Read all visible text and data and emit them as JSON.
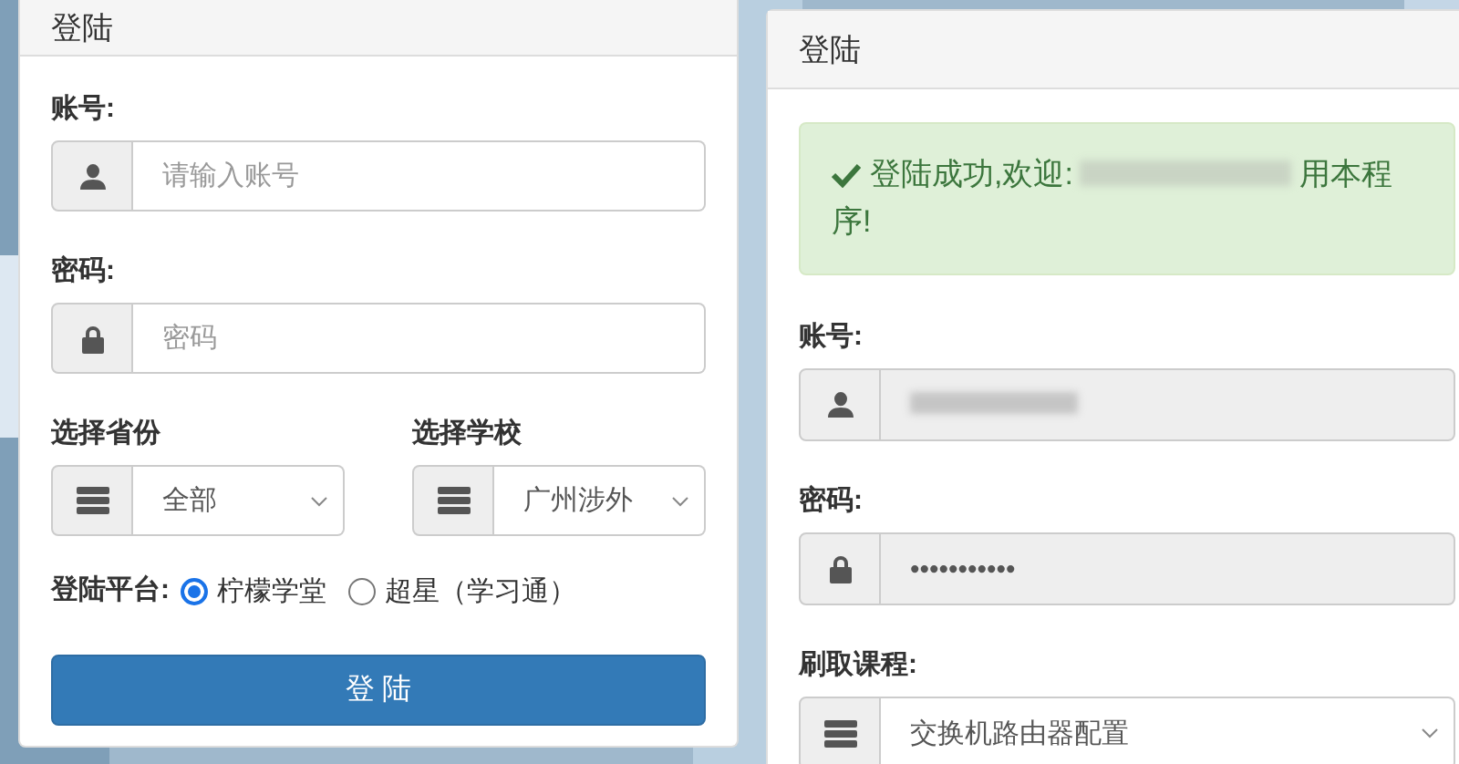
{
  "panels": [
    {
      "title": "登陆",
      "fields": [
        {
          "kind": "account",
          "label": "账号:",
          "placeholder": "请输入账号",
          "disabled": false
        },
        {
          "kind": "password",
          "label": "密码:",
          "placeholder": "密码",
          "disabled": false
        }
      ],
      "selects": [
        {
          "label": "选择省份",
          "value": "全部"
        },
        {
          "label": "选择学校",
          "value": "广州涉外"
        }
      ],
      "platform": {
        "label": "登陆平台:",
        "options": [
          {
            "label": "柠檬学堂",
            "selected": true
          },
          {
            "label": "超星（学习通）",
            "selected": false
          }
        ]
      },
      "button": "登 陆"
    },
    {
      "title": "登陆",
      "alert": {
        "before": "登陆成功,欢迎:",
        "redacted": true,
        "after": "用本程序!"
      },
      "fields": [
        {
          "kind": "account",
          "label": "账号:",
          "redacted": true,
          "disabled": true
        },
        {
          "kind": "password",
          "label": "密码:",
          "value": "•••••••••••",
          "disabled": true
        }
      ],
      "course": {
        "label": "刷取课程:",
        "value": "交换机路由器配置"
      }
    }
  ]
}
